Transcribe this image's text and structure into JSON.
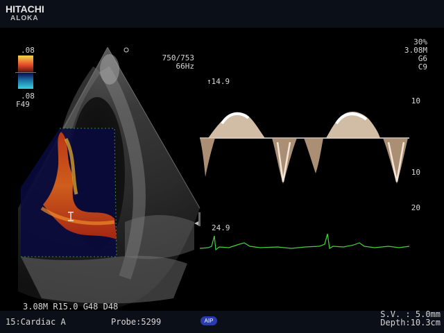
{
  "brand": {
    "name": "HITACHI",
    "sub": "ALOKA"
  },
  "colorbar": {
    "top_label": ".08",
    "bottom_label": ".08",
    "filter": "F49"
  },
  "image_info": {
    "frame": "750/753",
    "rate": "66Hz"
  },
  "doppler_settings": {
    "power": "30%",
    "freq": "3.08M",
    "gain": "G6",
    "curve": "C9"
  },
  "doppler_scale": {
    "max_label": "↑14.9",
    "ticks": [
      "10",
      "10",
      "20"
    ]
  },
  "ecg": {
    "value": "24.9"
  },
  "bmode_params": "3.08M R15.0 G48 D48",
  "status": {
    "preset": "15:Cardiac A",
    "probe": "Probe:5299",
    "aip": "AIP",
    "sample_volume": "S.V. : 5.0mm",
    "depth": "Depth:10.3cm"
  },
  "colors": {
    "ecg": "#43d63a",
    "doppler": "#f0e0cc",
    "baseline": "#e6e6e6"
  }
}
